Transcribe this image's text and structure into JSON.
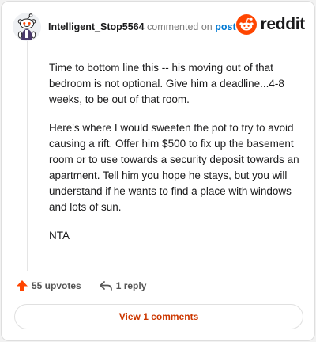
{
  "comment": {
    "username": "Intelligent_Stop5564",
    "action_text": "commented on",
    "target_link": "post",
    "paragraphs": [
      "Time to bottom line this -- his moving out of that bedroom is not optional. Give him a deadline...4-8 weeks, to be out of that room.",
      "Here's where I would sweeten the pot to try to avoid causing a rift. Offer him $500 to fix up the basement room or to use towards a security deposit towards an apartment. Tell him you hope he stays, but you will understand if he wants to find a place with windows and lots of sun.",
      "NTA"
    ]
  },
  "brand": {
    "wordmark": "reddit",
    "color": "#ff4500"
  },
  "actions": {
    "upvotes": "55 upvotes",
    "replies": "1 reply",
    "upvote_color": "#ff4500"
  },
  "footer": {
    "view_comments": "View 1 comments"
  },
  "icons": {
    "avatar": "snoo-avatar-icon",
    "logo": "reddit-logo-icon",
    "upvote": "upvote-arrow-icon",
    "reply": "reply-arrow-icon"
  }
}
